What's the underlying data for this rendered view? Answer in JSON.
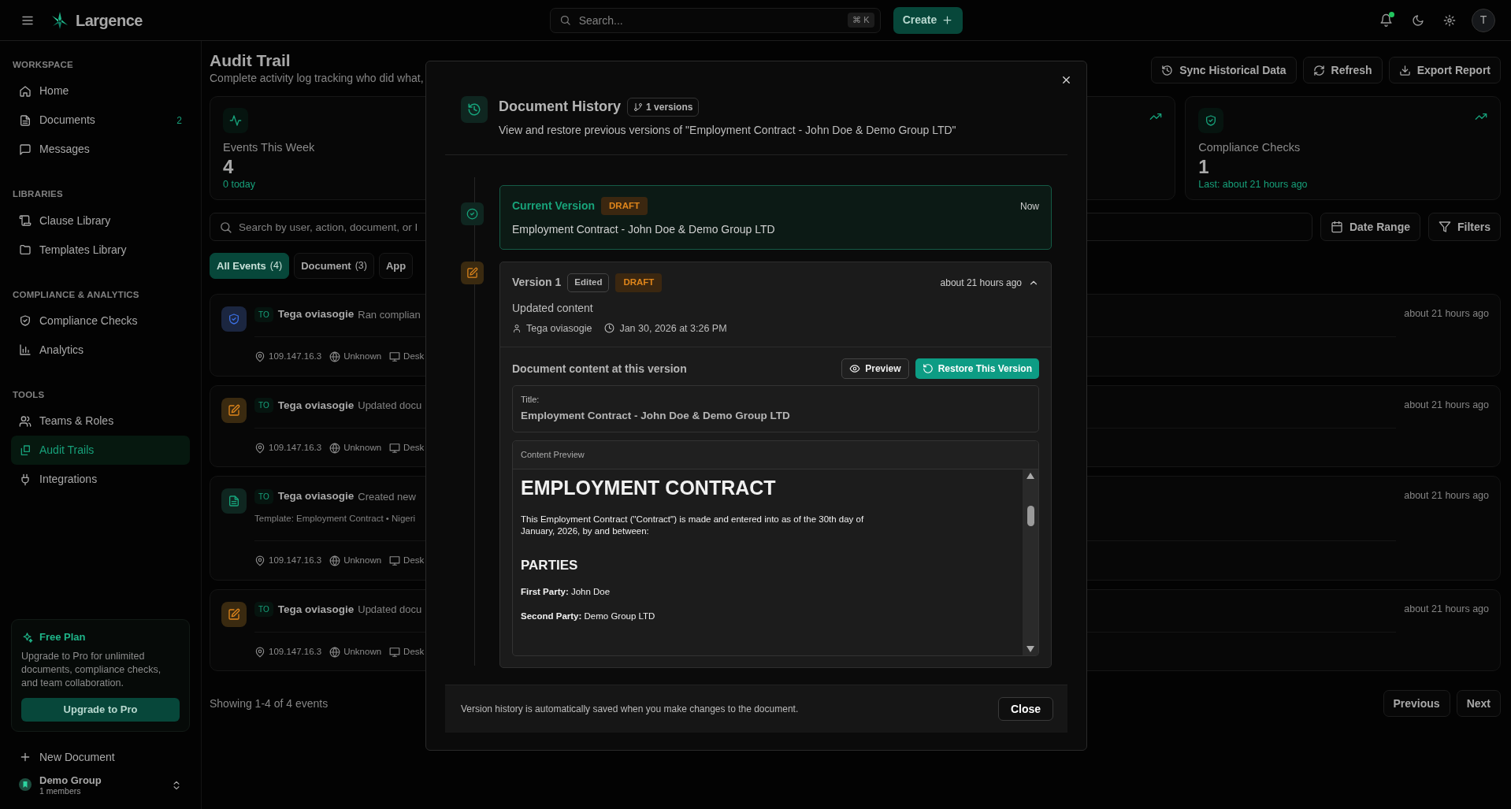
{
  "app": {
    "name": "Largence"
  },
  "topbar": {
    "search_placeholder": "Search...",
    "shortcut": "⌘ K",
    "create_button": "Create",
    "has_notification": true,
    "avatar": "T"
  },
  "sidebar": {
    "sections": [
      {
        "title": "WORKSPACE",
        "items": [
          {
            "label": "Home",
            "selected": false
          },
          {
            "label": "Documents",
            "count": "2",
            "selected": false
          },
          {
            "label": "Messages",
            "selected": false
          }
        ]
      },
      {
        "title": "LIBRARIES",
        "items": [
          {
            "label": "Clause Library",
            "selected": false
          },
          {
            "label": "Templates Library",
            "selected": false
          }
        ]
      },
      {
        "title": "COMPLIANCE & ANALYTICS",
        "items": [
          {
            "label": "Compliance Checks",
            "selected": false
          },
          {
            "label": "Analytics",
            "selected": false
          }
        ]
      },
      {
        "title": "TOOLS",
        "items": [
          {
            "label": "Teams & Roles",
            "selected": false
          },
          {
            "label": "Audit Trails",
            "selected": true
          },
          {
            "label": "Integrations",
            "selected": false
          }
        ]
      }
    ],
    "plan": {
      "title": "Free Plan",
      "text": "Upgrade to Pro for unlimited documents, compliance checks, and team collaboration.",
      "button": "Upgrade to Pro"
    },
    "new_document": "New Document",
    "workspace": {
      "name": "Demo Group",
      "members": "1 members"
    }
  },
  "page": {
    "title": "Audit Trail",
    "subtitle": "Complete activity log tracking who did what,",
    "actions": [
      "Sync Historical Data",
      "Refresh",
      "Export Report"
    ]
  },
  "stats": [
    {
      "label": "Events This Week",
      "value": "4",
      "note": "0 today"
    },
    {
      "label": "Compliance Checks",
      "value": "1",
      "note": "Last: about 21 hours ago"
    }
  ],
  "filters": {
    "search_placeholder": "Search by user, action, document, or I",
    "buttons": [
      "Date Range",
      "Filters"
    ]
  },
  "tabs": [
    {
      "label": "All Events",
      "count": "(4)",
      "selected": true
    },
    {
      "label": "Document",
      "count": "(3)",
      "selected": false
    },
    {
      "label": "App",
      "selected": false
    }
  ],
  "events": [
    {
      "kind": "compliance",
      "initials": "TO",
      "user": "Tega oviasogie",
      "action": "Ran complian",
      "ip": "109.147.16.3",
      "location": "Unknown",
      "device": "Desk",
      "time": "about 21 hours ago"
    },
    {
      "kind": "edit",
      "initials": "TO",
      "user": "Tega oviasogie",
      "action": "Updated docu",
      "ip": "109.147.16.3",
      "location": "Unknown",
      "device": "Desk",
      "time": "about 21 hours ago"
    },
    {
      "kind": "create",
      "initials": "TO",
      "user": "Tega oviasogie",
      "action": "Created new",
      "detail": "Template: Employment Contract • Nigeri",
      "ip": "109.147.16.3",
      "location": "Unknown",
      "device": "Desk",
      "time": "about 21 hours ago"
    },
    {
      "kind": "edit",
      "initials": "TO",
      "user": "Tega oviasogie",
      "action": "Updated docu",
      "ip": "109.147.16.3",
      "location": "Unknown",
      "device": "Desk",
      "time": "about 21 hours ago"
    }
  ],
  "pagination": {
    "summary": "Showing 1-4 of 4 events",
    "buttons": [
      "Previous",
      "Next"
    ]
  },
  "modal": {
    "title": "Document History",
    "badge": "1 versions",
    "subtitle": "View and restore previous versions of \"Employment Contract - John Doe & Demo Group LTD\"",
    "current": {
      "label": "Current Version",
      "status": "DRAFT",
      "title": "Employment Contract - John Doe & Demo Group LTD",
      "time": "Now"
    },
    "versions": [
      {
        "label": "Version 1",
        "tag": "Edited",
        "status": "DRAFT",
        "time": "about 21 hours ago",
        "expanded": true,
        "summary": "Updated content",
        "author": "Tega oviasogie",
        "date": "Jan 30, 2026 at 3:26 PM",
        "content": {
          "heading": "Document content at this version",
          "preview_button": "Preview",
          "restore_button": "Restore This Version",
          "title_label": "Title:",
          "title": "Employment Contract - John Doe & Demo Group LTD",
          "preview_label": "Content Preview",
          "document": [
            {
              "kind": "h1",
              "text": "EMPLOYMENT CONTRACT"
            },
            {
              "kind": "p",
              "text": "This Employment Contract (\"Contract\") is made and entered into as of the 30th day of January, 2026, by and between:"
            },
            {
              "kind": "h2",
              "text": "PARTIES"
            },
            {
              "kind": "p",
              "text": "**First Party:** John Doe"
            },
            {
              "kind": "p",
              "text": "**Second Party:** Demo Group LTD"
            }
          ]
        }
      }
    ],
    "footer_note": "Version history is automatically saved when you make changes to the document.",
    "close_button": "Close"
  }
}
